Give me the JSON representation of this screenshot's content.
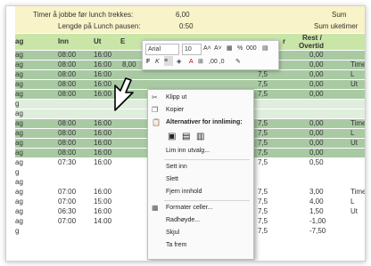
{
  "top": {
    "lunch_label": "Timer å jobbe før lunch trekkes:",
    "lunch_value": "6,00",
    "pause_label": "Lengde på Lunch pausen:",
    "pause_value": "0:50",
    "sum1": "Sum",
    "sum2": "Sum uketimer"
  },
  "headers": {
    "day": "ag",
    "inn": "Inn",
    "ut": "Ut",
    "extra": "E",
    "r": "r",
    "rest1": "Rest /",
    "rest2": "Overtid"
  },
  "rows": [
    {
      "day": "ag",
      "inn": "08:00",
      "ut": "16:00",
      "a": "",
      "b": "",
      "rest": "0,00",
      "note": "",
      "shade": "g"
    },
    {
      "day": "ag",
      "inn": "08:00",
      "ut": "16:00",
      "a": "8,00",
      "b": "0,5",
      "hrs": "7,5",
      "rest": "0,00",
      "note": "Time",
      "shade": "g"
    },
    {
      "day": "ag",
      "inn": "08:00",
      "ut": "16:00",
      "a": "",
      "b": "",
      "hrs": "7,5",
      "rest": "0,00",
      "note": "L",
      "shade": "g"
    },
    {
      "day": "ag",
      "inn": "08:00",
      "ut": "16:00",
      "a": "",
      "b": "",
      "hrs": "7,5",
      "rest": "0,00",
      "note": "Ut",
      "shade": "g"
    },
    {
      "day": "ag",
      "inn": "08:00",
      "ut": "16:00",
      "a": "",
      "b": "",
      "hrs": "7,5",
      "rest": "0,00",
      "note": "",
      "shade": "g"
    },
    {
      "day": "g",
      "inn": "",
      "ut": "",
      "a": "",
      "b": "",
      "hrs": "",
      "rest": "",
      "note": "",
      "shade": "gl"
    },
    {
      "day": "ag",
      "inn": "",
      "ut": "",
      "a": "",
      "b": "",
      "hrs": "",
      "rest": "",
      "note": "",
      "shade": "gl"
    },
    {
      "day": "ag",
      "inn": "08:00",
      "ut": "16:00",
      "a": "",
      "b": "",
      "hrs": "7,5",
      "rest": "0,00",
      "note": "Time",
      "shade": "g"
    },
    {
      "day": "ag",
      "inn": "08:00",
      "ut": "16:00",
      "a": "",
      "b": "",
      "hrs": "7,5",
      "rest": "0,00",
      "note": "L",
      "shade": "g"
    },
    {
      "day": "ag",
      "inn": "08:00",
      "ut": "16:00",
      "a": "",
      "b": "",
      "hrs": "7,5",
      "rest": "0,00",
      "note": "Ut",
      "shade": "g"
    },
    {
      "day": "ag",
      "inn": "08:00",
      "ut": "16:00",
      "a": "",
      "b": "",
      "hrs": "7,5",
      "rest": "0,00",
      "note": "",
      "shade": "g"
    },
    {
      "day": "ag",
      "inn": "07:30",
      "ut": "16:00",
      "a": "",
      "b": "",
      "hrs": "7,5",
      "rest": "0,50",
      "note": "",
      "shade": "w"
    },
    {
      "day": "g",
      "inn": "",
      "ut": "",
      "a": "",
      "b": "",
      "hrs": "",
      "rest": "",
      "note": "",
      "shade": "w"
    },
    {
      "day": "ag",
      "inn": "",
      "ut": "",
      "a": "",
      "b": "",
      "hrs": "",
      "rest": "",
      "note": "",
      "shade": "w"
    },
    {
      "day": "ag",
      "inn": "07:00",
      "ut": "16:00",
      "a": "",
      "b": "",
      "hrs": "7,5",
      "rest": "3,00",
      "note": "Time",
      "shade": "w"
    },
    {
      "day": "ag",
      "inn": "07:00",
      "ut": "15:00",
      "a": "",
      "b": "",
      "hrs": "7,5",
      "rest": "4,00",
      "note": "L",
      "shade": "w"
    },
    {
      "day": "ag",
      "inn": "06:30",
      "ut": "16:00",
      "a": "",
      "b": "",
      "hrs": "7,5",
      "rest": "1,50",
      "note": "Ut",
      "shade": "w"
    },
    {
      "day": "ag",
      "inn": "07:00",
      "ut": "14:00",
      "a": "",
      "b": "",
      "hrs": "7,5",
      "rest": "-1,00",
      "note": "",
      "shade": "w"
    },
    {
      "day": "g",
      "inn": "",
      "ut": "",
      "a": "",
      "b": "",
      "hrs": "7,5",
      "rest": "-7,50",
      "note": "",
      "shade": "w"
    }
  ],
  "toolbar": {
    "font_name": "Arial",
    "font_size": "10",
    "grow": "A˄",
    "shrink": "A˅",
    "percent": "%",
    "thousands": "000",
    "bold": "F",
    "italic": "K",
    "decimals": ",00 ,0"
  },
  "menu": {
    "cut": "Klipp ut",
    "copy": "Kopier",
    "paste_options": "Alternativer for innliming:",
    "paste_special": "Lim inn utvalg...",
    "insert": "Sett inn",
    "delete": "Slett",
    "clear": "Fjern innhold",
    "format_cells": "Formater celler...",
    "row_height": "Radhøyde...",
    "hide": "Skjul",
    "unhide": "Ta frem"
  }
}
